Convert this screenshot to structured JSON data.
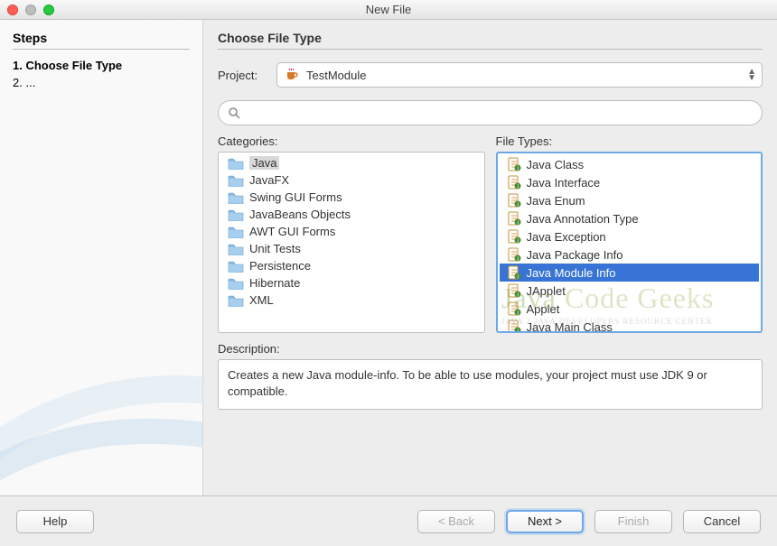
{
  "window": {
    "title": "New File"
  },
  "sidebar": {
    "heading": "Steps",
    "steps": [
      "Choose File Type",
      "..."
    ],
    "currentStep": 0
  },
  "main": {
    "heading": "Choose File Type",
    "project": {
      "label": "Project:",
      "selected": "TestModule"
    },
    "filter": {
      "placeholder": ""
    },
    "categories": {
      "label": "Categories:",
      "items": [
        "Java",
        "JavaFX",
        "Swing GUI Forms",
        "JavaBeans Objects",
        "AWT GUI Forms",
        "Unit Tests",
        "Persistence",
        "Hibernate",
        "XML"
      ],
      "selectedIndex": 0
    },
    "fileTypes": {
      "label": "File Types:",
      "items": [
        "Java Class",
        "Java Interface",
        "Java Enum",
        "Java Annotation Type",
        "Java Exception",
        "Java Package Info",
        "Java Module Info",
        "JApplet",
        "Applet",
        "Java Main Class"
      ],
      "selectedIndex": 6
    },
    "description": {
      "label": "Description:",
      "text": "Creates a new Java module-info. To be able to use modules, your project must use JDK 9 or compatible."
    }
  },
  "footer": {
    "help": "Help",
    "back": "< Back",
    "next": "Next >",
    "finish": "Finish",
    "cancel": "Cancel"
  },
  "watermark": {
    "line1a": "Java",
    "line1b": " Code Geeks",
    "line2": "JAVA 2 JAVA DEVELOPERS RESOURCE CENTER"
  }
}
